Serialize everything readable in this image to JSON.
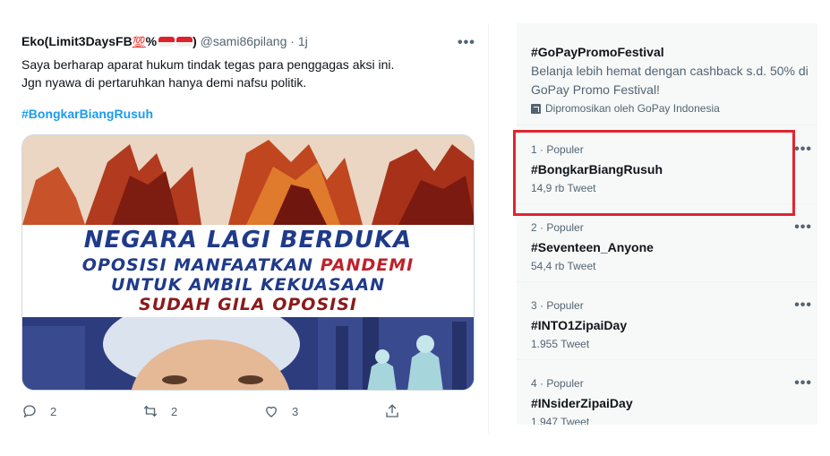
{
  "tweet": {
    "author_name": "Eko(Limit3DaysFB",
    "author_emoji": "💯",
    "author_suffix": "%",
    "author_close": ")",
    "handle": "@sami86pilang",
    "separator": "·",
    "time": "1j",
    "more": "•••",
    "text_line1": "Saya berharap aparat hukum tindak tegas para penggagas aksi ini.",
    "text_line2": "Jgn nyawa di pertaruhkan hanya demi nafsu politik.",
    "hashtag": "#BongkarBiangRusuh",
    "image": {
      "line1": "NEGARA LAGI BERDUKA",
      "line2_a": "OPOSISI MANFAATKAN ",
      "line2_b": "PANDEMI",
      "line3": "UNTUK AMBIL KEKUASAAN",
      "line4": "SUDAH GILA OPOSISI"
    },
    "actions": {
      "reply_count": "2",
      "retweet_count": "2",
      "like_count": "3"
    }
  },
  "trends": {
    "promoted": {
      "name": "#GoPayPromoFestival",
      "description": "Belanja lebih hemat dengan cashback s.d. 50% di GoPay Promo Festival!",
      "promoted_by": "Dipromosikan oleh GoPay Indonesia"
    },
    "items": [
      {
        "meta": "1 · Populer",
        "name": "#BongkarBiangRusuh",
        "count": "14,9 rb Tweet"
      },
      {
        "meta": "2 · Populer",
        "name": "#Seventeen_Anyone",
        "count": "54,4 rb Tweet"
      },
      {
        "meta": "3 · Populer",
        "name": "#INTO1ZipaiDay",
        "count": "1.955 Tweet"
      },
      {
        "meta": "4 · Populer",
        "name": "#INsiderZipaiDay",
        "count": "1.947 Tweet"
      }
    ],
    "more": "•••"
  },
  "colors": {
    "hashtag_blue": "#1d9bf0",
    "highlight_red": "#e0252e",
    "panel_bg": "#f7f9f9"
  }
}
